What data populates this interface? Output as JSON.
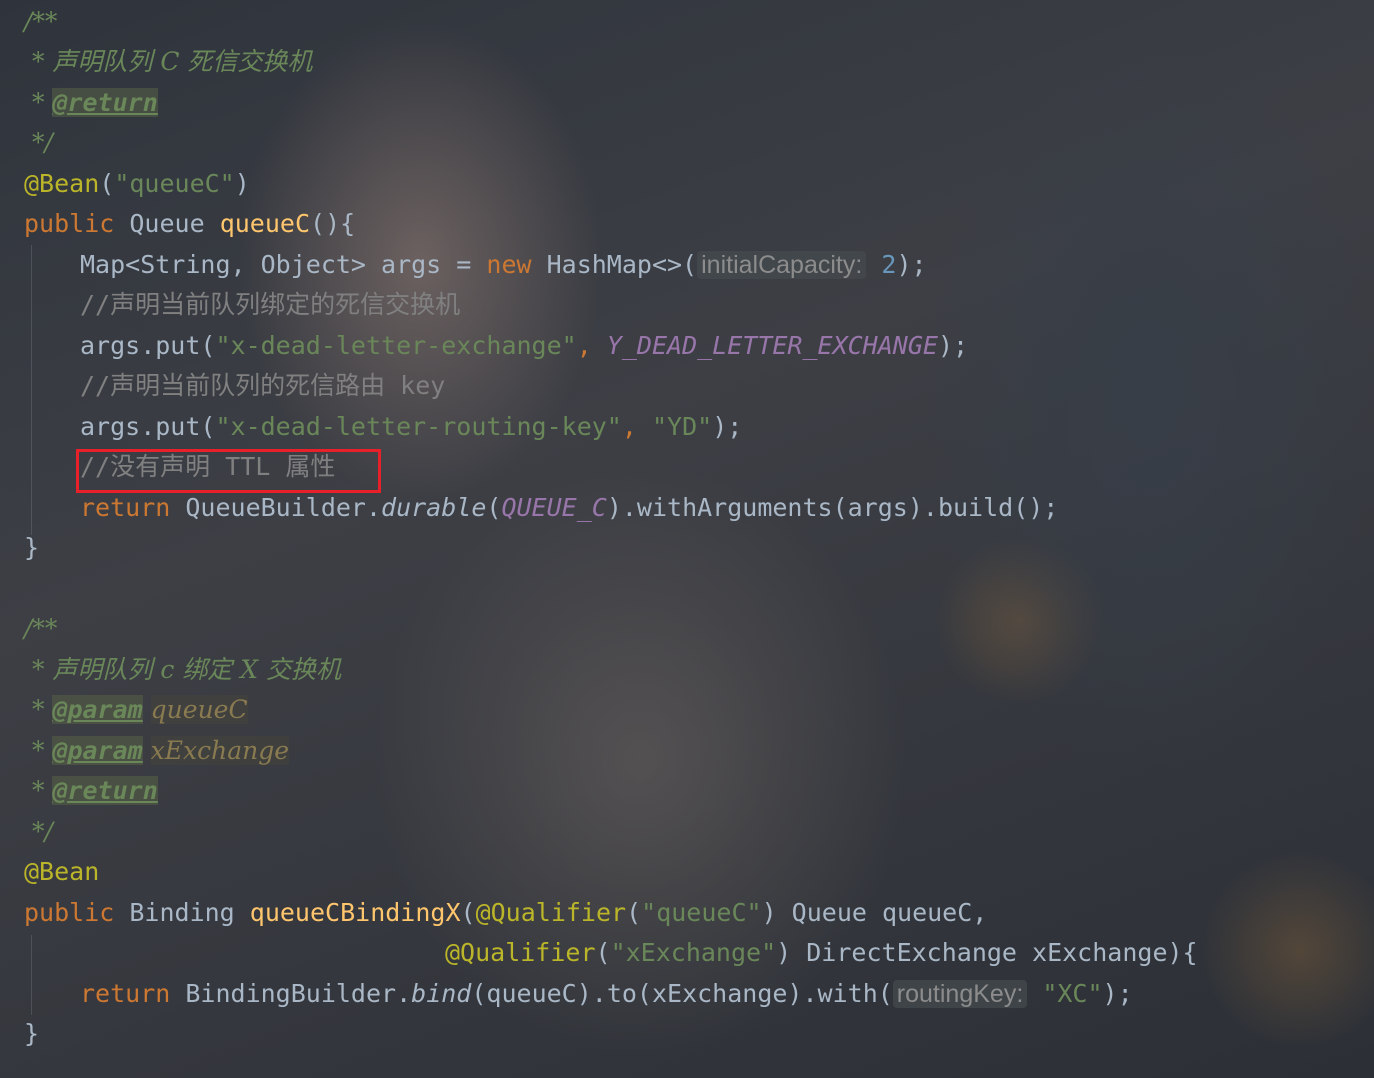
{
  "block1": {
    "doc_open": "/**",
    "doc_desc": " * 声明队列 C 死信交换机",
    "doc_star": " * ",
    "doc_return_tag": "@return",
    "doc_close": " */",
    "annotation": "@Bean",
    "annotation_arg": "\"queueC\"",
    "sig_public": "public",
    "sig_type": "Queue",
    "sig_name": "queueC",
    "sig_tail": "(){",
    "l1_map": "Map<String, Object> args = ",
    "l1_new": "new",
    "l1_hashmap": " HashMap<>(",
    "l1_hint": "initialCapacity:",
    "l1_num": "2",
    "l1_end": ");",
    "l2_comment": "//声明当前队列绑定的死信交换机",
    "l3_call": "args.put(",
    "l3_str": "\"x-dead-letter-exchange\"",
    "l3_comma": ", ",
    "l3_const": "Y_DEAD_LETTER_EXCHANGE",
    "l3_end": ");",
    "l4_comment": "//声明当前队列的死信路由 key",
    "l5_call": "args.put(",
    "l5_str1": "\"x-dead-letter-routing-key\"",
    "l5_comma": ", ",
    "l5_str2": "\"YD\"",
    "l5_end": ");",
    "l6_comment": "//没有声明 TTL 属性",
    "l7_return": "return",
    "l7_builder": " QueueBuilder.",
    "l7_durable": "durable",
    "l7_paren": "(",
    "l7_const": "QUEUE_C",
    "l7_rest": ").withArguments(args).build();",
    "close": "}"
  },
  "block2": {
    "doc_open": "/**",
    "doc_desc": " * 声明队列 c 绑定 X 交换机",
    "doc_star": " * ",
    "param_tag": "@param",
    "param1": "queueC",
    "param2": "xExchange",
    "return_tag": "@return",
    "doc_close": " */",
    "annotation": "@Bean",
    "sig_public": "public",
    "sig_type": " Binding ",
    "sig_name": "queueCBindingX",
    "sig_open": "(",
    "qualifier": "@Qualifier",
    "q1_arg": "\"queueC\"",
    "q1_rest": ") Queue queueC,",
    "q2_arg": "\"xExchange\"",
    "q2_rest": ") DirectExchange xExchange){",
    "l1_return": "return",
    "l1_builder": " BindingBuilder.",
    "l1_bind": "bind",
    "l1_mid": "(queueC).to(xExchange).with(",
    "l1_hint": "routingKey:",
    "l1_str": "\"XC\"",
    "l1_end": ");",
    "close": "}"
  }
}
